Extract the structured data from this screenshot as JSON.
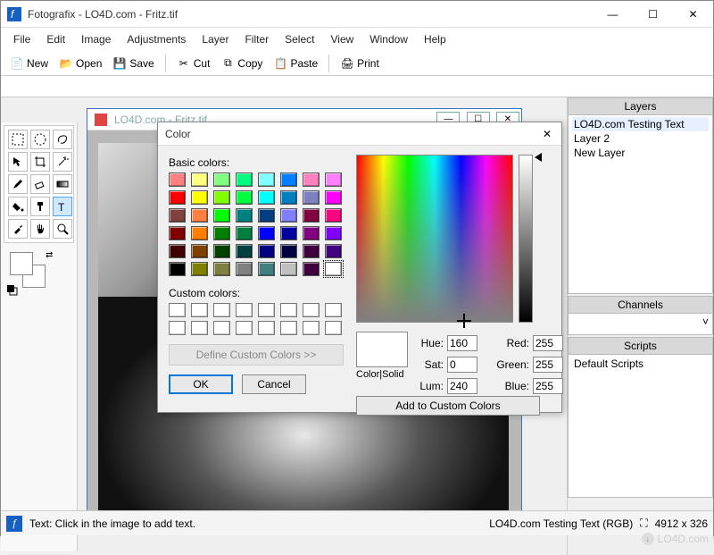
{
  "app": {
    "title": "Fotografix - LO4D.com - Fritz.tif",
    "menus": [
      "File",
      "Edit",
      "Image",
      "Adjustments",
      "Layer",
      "Filter",
      "Select",
      "View",
      "Window",
      "Help"
    ],
    "toolbar": {
      "new": "New",
      "open": "Open",
      "save": "Save",
      "cut": "Cut",
      "copy": "Copy",
      "paste": "Paste",
      "print": "Print"
    }
  },
  "tools": {
    "names": [
      "rect-select",
      "ellipse-select",
      "lasso",
      "move",
      "crop",
      "magic-wand",
      "brush",
      "eraser",
      "gradient",
      "bucket",
      "clone",
      "text",
      "eyedropper",
      "hand",
      "zoom"
    ],
    "selected": 11
  },
  "mdi": {
    "title": "LO4D.com - Fritz.tif"
  },
  "panels": {
    "layers": {
      "title": "Layers",
      "items": [
        "LO4D.com Testing Text",
        "Layer 2",
        "New Layer"
      ]
    },
    "channels": {
      "title": "Channels"
    },
    "scripts": {
      "title": "Scripts",
      "items": [
        "Default Scripts"
      ]
    }
  },
  "status": {
    "text": "Text: Click in the image to add text.",
    "info": "LO4D.com Testing Text (RGB)",
    "dims": "4912 x 326"
  },
  "dialog": {
    "title": "Color",
    "basic_label": "Basic colors:",
    "custom_label": "Custom colors:",
    "define": "Define Custom Colors >>",
    "ok": "OK",
    "cancel": "Cancel",
    "colorsolid": "Color|Solid",
    "labels": {
      "hue": "Hue:",
      "sat": "Sat:",
      "lum": "Lum:",
      "red": "Red:",
      "green": "Green:",
      "blue": "Blue:"
    },
    "values": {
      "hue": "160",
      "sat": "0",
      "lum": "240",
      "red": "255",
      "green": "255",
      "blue": "255"
    },
    "addcustom": "Add to Custom Colors",
    "basic_colors": [
      "#ff8080",
      "#ffff80",
      "#80ff80",
      "#00ff80",
      "#80ffff",
      "#0080ff",
      "#ff80c0",
      "#ff80ff",
      "#ff0000",
      "#ffff00",
      "#80ff00",
      "#00ff40",
      "#00ffff",
      "#0080c0",
      "#8080c0",
      "#ff00ff",
      "#804040",
      "#ff8040",
      "#00ff00",
      "#008080",
      "#004080",
      "#8080ff",
      "#800040",
      "#ff0080",
      "#800000",
      "#ff8000",
      "#008000",
      "#008040",
      "#0000ff",
      "#0000a0",
      "#800080",
      "#8000ff",
      "#400000",
      "#804000",
      "#004000",
      "#004040",
      "#000080",
      "#000040",
      "#400040",
      "#400080",
      "#000000",
      "#808000",
      "#808040",
      "#808080",
      "#408080",
      "#c0c0c0",
      "#400040",
      "#ffffff"
    ],
    "selected_basic": 47
  },
  "watermark": "LO4D.com"
}
